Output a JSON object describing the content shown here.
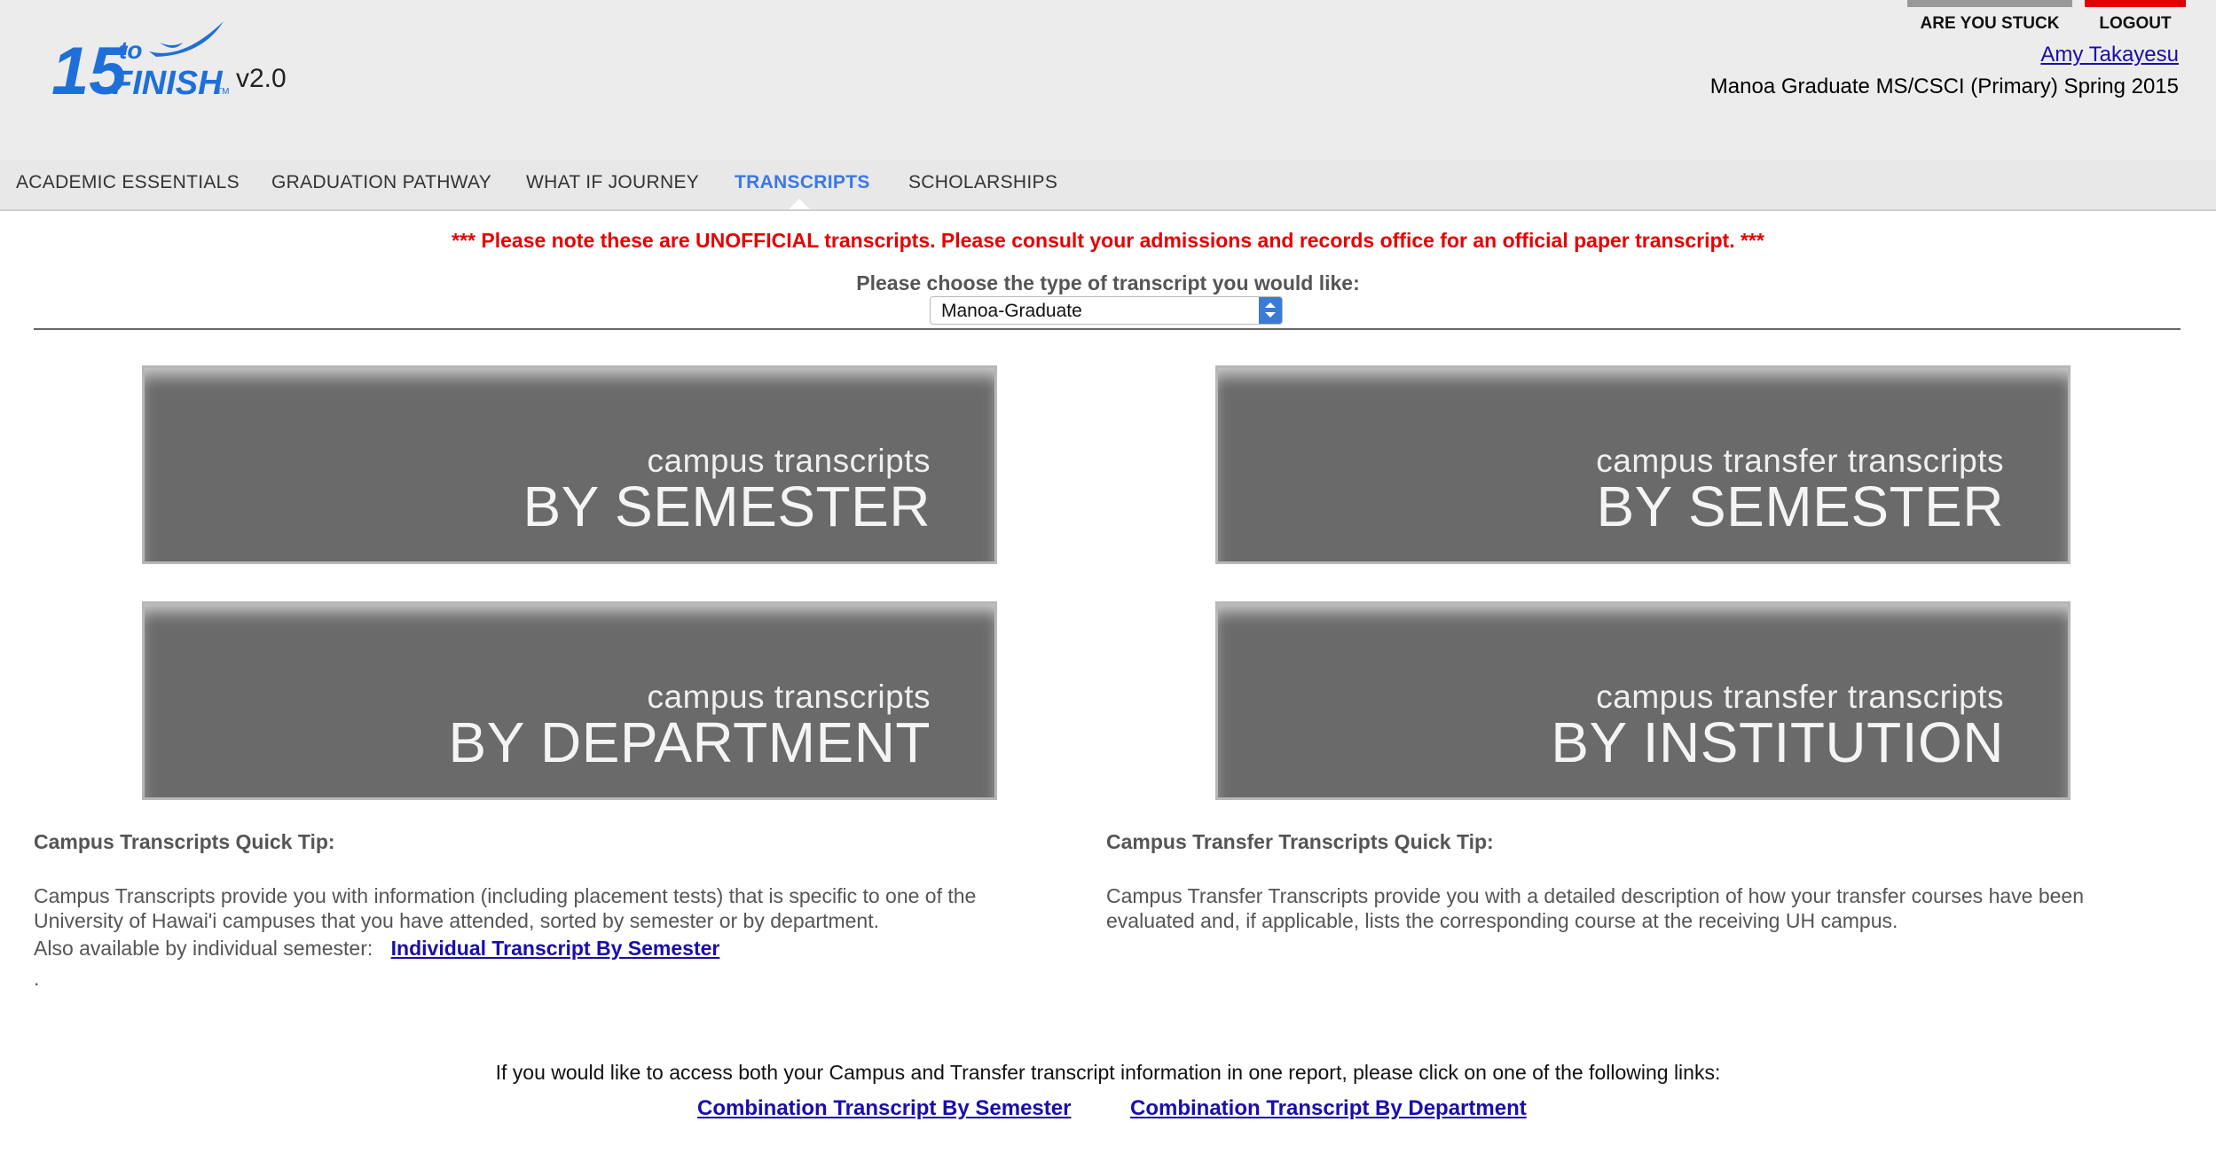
{
  "app": {
    "logo_text": "15 to FINISH",
    "version": "v2.0"
  },
  "header": {
    "are_you_stuck": "ARE YOU STUCK",
    "logout": "LOGOUT",
    "user_name": "Amy Takayesu",
    "program": "Manoa Graduate MS/CSCI (Primary) Spring 2015"
  },
  "nav": {
    "items": [
      {
        "label": "ACADEMIC ESSENTIALS"
      },
      {
        "label": "GRADUATION PATHWAY"
      },
      {
        "label": "WHAT IF JOURNEY"
      },
      {
        "label": "TRANSCRIPTS"
      },
      {
        "label": "SCHOLARSHIPS"
      }
    ],
    "active": "TRANSCRIPTS"
  },
  "notice": "*** Please note these are UNOFFICIAL transcripts. Please consult your admissions and records office for an official paper transcript. ***",
  "transcript_type": {
    "label": "Please choose the type of transcript you would like:",
    "selected": "Manoa-Graduate"
  },
  "tiles": [
    {
      "small": "campus transcripts",
      "big": "BY SEMESTER"
    },
    {
      "small": "campus transfer transcripts",
      "big": "BY SEMESTER"
    },
    {
      "small": "campus transcripts",
      "big": "BY DEPARTMENT"
    },
    {
      "small": "campus transfer transcripts",
      "big": "BY INSTITUTION"
    }
  ],
  "campus_tip": {
    "title": "Campus Transcripts Quick Tip:",
    "line1": "Campus Transcripts provide you with information (including placement tests) that is specific to one of the",
    "line2": "University of Hawai'i campuses that you have attended, sorted by semester or by department.",
    "also_label": "Also available by individual semester:",
    "also_link": "Individual Transcript By Semester",
    "trailing": "."
  },
  "transfer_tip": {
    "title": "Campus Transfer Transcripts Quick Tip:",
    "line1": "Campus Transfer Transcripts provide you with a detailed description of how your transfer courses have been",
    "line2": "evaluated and, if applicable, lists the corresponding course at the receiving UH campus."
  },
  "combination": {
    "text": "If you would like to access both your Campus and Transfer transcript information in one report, please click on one of the following links:",
    "link_semester": "Combination Transcript By Semester",
    "link_department": "Combination Transcript By Department"
  },
  "colors": {
    "notice": "#e60000",
    "active_tab": "#3b78e7",
    "link": "#1a0dab",
    "tile": "#6a6a6a",
    "logo": "#1e6fd9"
  }
}
